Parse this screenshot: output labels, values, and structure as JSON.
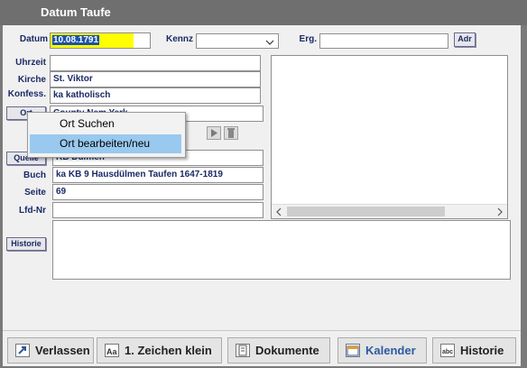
{
  "window": {
    "title": "Datum Taufe"
  },
  "form": {
    "datum_label": "Datum",
    "datum_value": "10.08.1791",
    "kennz_label": "Kennz",
    "kennz_value": "",
    "erg_label": "Erg.",
    "erg_value": "",
    "adr_button": "Adr",
    "uhrzeit_label": "Uhrzeit",
    "uhrzeit_value": "",
    "kirche_label": "Kirche",
    "kirche_value": "St. Viktor",
    "konfess_label": "Konfess.",
    "konfess_value": "ka  katholisch",
    "ort_button": "Ort",
    "ort_value": "County Nem Yerk",
    "quelle_button": "Quelle",
    "quelle_value": "KB Dülmen",
    "buch_label": "Buch",
    "buch_value": "ka KB  9 Hausdülmen Taufen 1647-1819",
    "seite_label": "Seite",
    "seite_value": "69",
    "lfdnr_label": "Lfd-Nr",
    "lfdnr_value": "",
    "historie_button": "Historie",
    "historie_text": ""
  },
  "context_menu": {
    "items": [
      "Ort Suchen",
      "Ort bearbeiten/neu"
    ],
    "selected_index": 1
  },
  "bottom_buttons": {
    "verlassen": "Verlassen",
    "zeichen": "1. Zeichen klein",
    "dokumente": "Dokumente",
    "kalender": "Kalender",
    "historie": "Historie"
  },
  "colors": {
    "accent_blue": "#2c5aa0",
    "date_highlight": "#ffff00",
    "menu_select": "#99c9ef",
    "label_text": "#1a2a66"
  }
}
